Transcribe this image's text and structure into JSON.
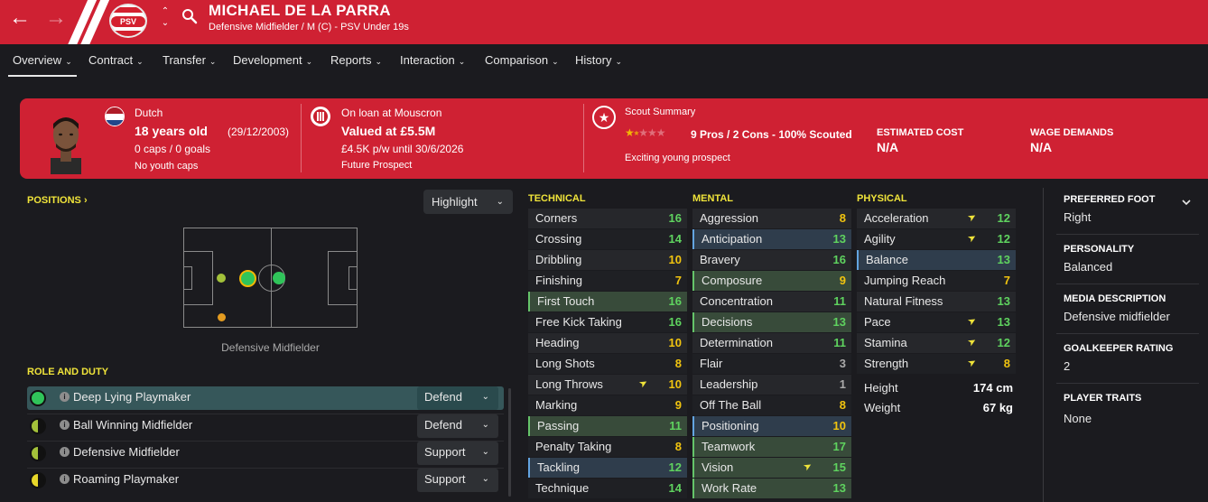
{
  "header": {
    "player_name": "MICHAEL DE LA PARRA",
    "player_subtitle": "Defensive Midfielder / M (C) - PSV Under 19s",
    "club_crest_text": "PSV",
    "back_icon": "arrow-left-icon",
    "forward_icon": "arrow-right-icon",
    "search_icon": "search-icon"
  },
  "tabs": [
    {
      "label": "Overview",
      "active": true
    },
    {
      "label": "Contract"
    },
    {
      "label": "Transfer"
    },
    {
      "label": "Development"
    },
    {
      "label": "Reports"
    },
    {
      "label": "Interaction"
    },
    {
      "label": "Comparison"
    },
    {
      "label": "History"
    }
  ],
  "info": {
    "nationality": "Dutch",
    "age": "18 years old",
    "dob": "(29/12/2003)",
    "caps": "0 caps / 0 goals",
    "youth_caps": "No youth caps",
    "loan_status": "On loan at Mouscron",
    "value": "Valued at £5.5M",
    "wage": "£4.5K p/w until 30/6/2026",
    "prospect": "Future Prospect",
    "scout_label": "Scout Summary",
    "scout_summary": "9 Pros / 2 Cons - 100% Scouted",
    "scout_rating_stars": 1.5,
    "scout_note": "Exciting young prospect",
    "est_cost_label": "ESTIMATED COST",
    "est_cost": "N/A",
    "wage_demands_label": "WAGE DEMANDS",
    "wage_demands": "N/A",
    "colors": {
      "red": "#cf2133",
      "accent_yellow": "#f0e43a"
    }
  },
  "positions": {
    "label": "POSITIONS",
    "highlight_label": "Highlight",
    "caption": "Defensive Midfielder"
  },
  "roles": {
    "label": "ROLE AND DUTY",
    "items": [
      {
        "name": "Deep Lying Playmaker",
        "duty": "Defend",
        "selected": true,
        "dot": "green"
      },
      {
        "name": "Ball Winning Midfielder",
        "duty": "Defend",
        "dot": "half-green"
      },
      {
        "name": "Defensive Midfielder",
        "duty": "Support",
        "dot": "half-green"
      },
      {
        "name": "Roaming Playmaker",
        "duty": "Support",
        "dot": "half-yellow"
      }
    ]
  },
  "attributes": {
    "technical_label": "TECHNICAL",
    "mental_label": "MENTAL",
    "physical_label": "PHYSICAL",
    "technical": [
      {
        "name": "Corners",
        "value": "16"
      },
      {
        "name": "Crossing",
        "value": "14"
      },
      {
        "name": "Dribbling",
        "value": "10"
      },
      {
        "name": "Finishing",
        "value": "7"
      },
      {
        "name": "First Touch",
        "value": "16",
        "hl": "green"
      },
      {
        "name": "Free Kick Taking",
        "value": "16"
      },
      {
        "name": "Heading",
        "value": "10"
      },
      {
        "name": "Long Shots",
        "value": "8"
      },
      {
        "name": "Long Throws",
        "value": "10",
        "arrow": true
      },
      {
        "name": "Marking",
        "value": "9"
      },
      {
        "name": "Passing",
        "value": "11",
        "hl": "green"
      },
      {
        "name": "Penalty Taking",
        "value": "8"
      },
      {
        "name": "Tackling",
        "value": "12",
        "hl": "blue"
      },
      {
        "name": "Technique",
        "value": "14"
      }
    ],
    "mental": [
      {
        "name": "Aggression",
        "value": "8"
      },
      {
        "name": "Anticipation",
        "value": "13",
        "hl": "blue"
      },
      {
        "name": "Bravery",
        "value": "16"
      },
      {
        "name": "Composure",
        "value": "9",
        "hl": "green"
      },
      {
        "name": "Concentration",
        "value": "11"
      },
      {
        "name": "Decisions",
        "value": "13",
        "hl": "green"
      },
      {
        "name": "Determination",
        "value": "11"
      },
      {
        "name": "Flair",
        "value": "3"
      },
      {
        "name": "Leadership",
        "value": "1"
      },
      {
        "name": "Off The Ball",
        "value": "8"
      },
      {
        "name": "Positioning",
        "value": "10",
        "hl": "blue"
      },
      {
        "name": "Teamwork",
        "value": "17",
        "hl": "green"
      },
      {
        "name": "Vision",
        "value": "15",
        "hl": "green",
        "arrow": true
      },
      {
        "name": "Work Rate",
        "value": "13",
        "hl": "green"
      }
    ],
    "physical": [
      {
        "name": "Acceleration",
        "value": "12",
        "arrow": true
      },
      {
        "name": "Agility",
        "value": "12",
        "arrow": true
      },
      {
        "name": "Balance",
        "value": "13",
        "hl": "blue"
      },
      {
        "name": "Jumping Reach",
        "value": "7"
      },
      {
        "name": "Natural Fitness",
        "value": "13"
      },
      {
        "name": "Pace",
        "value": "13",
        "arrow": true
      },
      {
        "name": "Stamina",
        "value": "12",
        "arrow": true
      },
      {
        "name": "Strength",
        "value": "8",
        "arrow": true
      }
    ],
    "height_label": "Height",
    "height": "174 cm",
    "weight_label": "Weight",
    "weight": "67 kg"
  },
  "right_panel": {
    "preferred_foot_label": "PREFERRED FOOT",
    "preferred_foot": "Right",
    "personality_label": "PERSONALITY",
    "personality": "Balanced",
    "media_label": "MEDIA DESCRIPTION",
    "media": "Defensive midfielder",
    "gk_label": "GOALKEEPER RATING",
    "gk": "2",
    "traits_label": "PLAYER TRAITS",
    "traits": "None"
  }
}
